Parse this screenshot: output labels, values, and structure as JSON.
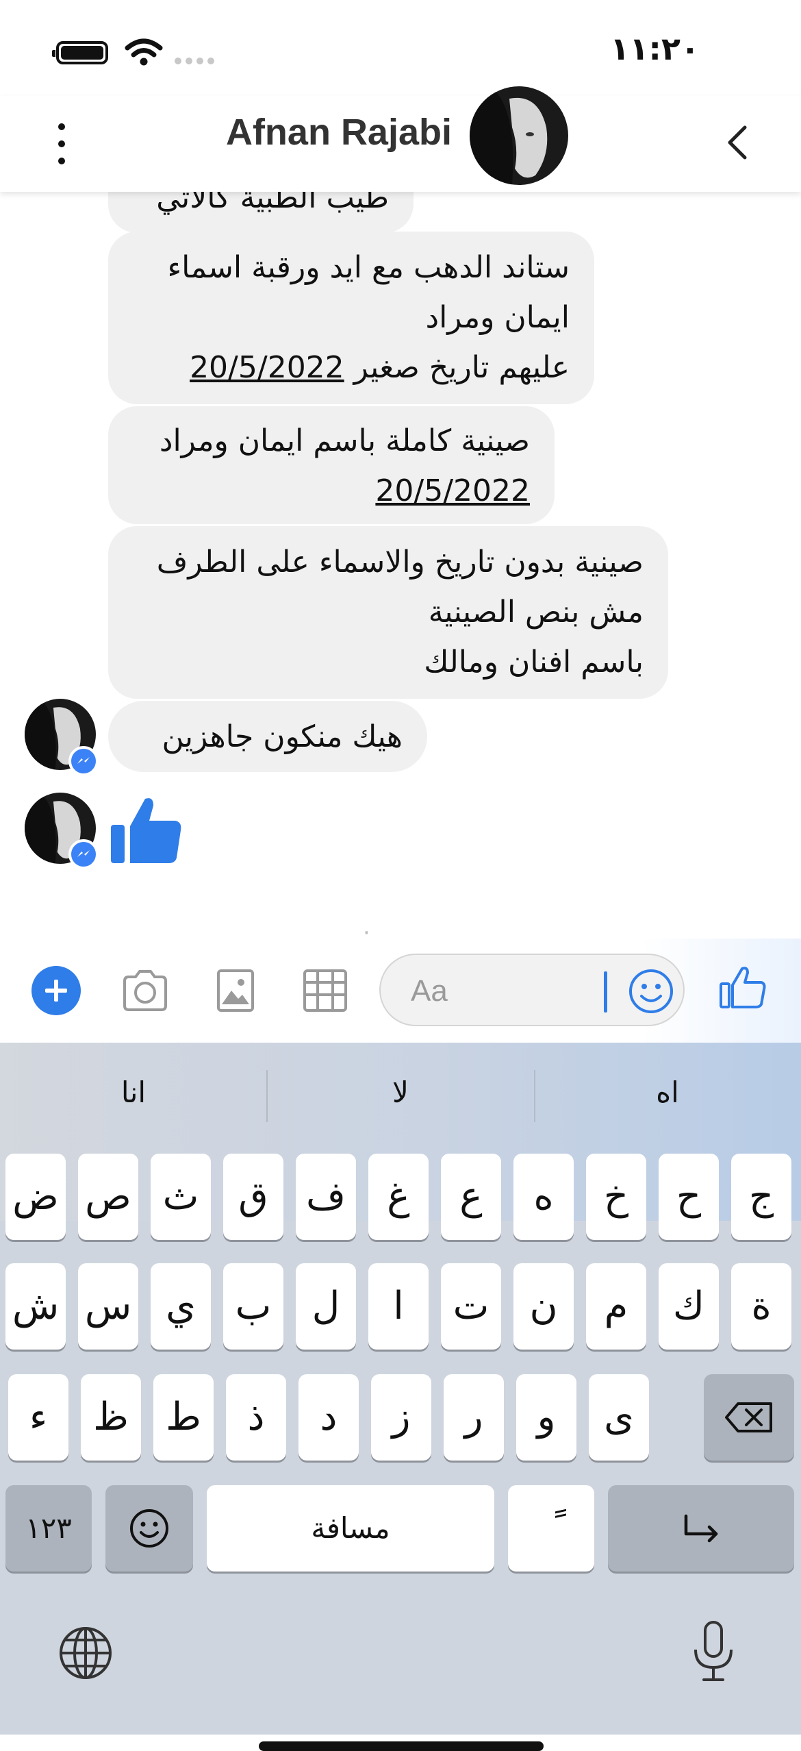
{
  "status_bar": {
    "time": "١١:٢٠"
  },
  "header": {
    "contact_name": "Afnan Rajabi"
  },
  "messages": [
    {
      "lines": [
        "طيب الطبية كالاتي"
      ]
    },
    {
      "lines": [
        "ستاند الدهب مع ايد ورقبة اسماء",
        "ايمان ومراد",
        "عليهم تاريخ صغير"
      ],
      "date": "20/5/2022"
    },
    {
      "lines": [
        "صينية كاملة باسم ايمان ومراد"
      ],
      "date": "20/5/2022"
    },
    {
      "lines": [
        "صينية بدون تاريخ والاسماء على الطرف",
        "مش بنص الصينية",
        "باسم افنان ومالك"
      ]
    },
    {
      "lines": [
        "هيك منكون جاهزين"
      ]
    }
  ],
  "composer": {
    "placeholder": "Aa"
  },
  "keyboard": {
    "suggestions": [
      "انا",
      "لا",
      "اه"
    ],
    "row1": [
      "ج",
      "ح",
      "خ",
      "ه",
      "ع",
      "غ",
      "ف",
      "ق",
      "ث",
      "ص",
      "ض"
    ],
    "row2": [
      "ة",
      "ك",
      "م",
      "ن",
      "ت",
      "ا",
      "ل",
      "ب",
      "ي",
      "س",
      "ش"
    ],
    "row3": [
      "ى",
      "و",
      "ر",
      "ز",
      "د",
      "ذ",
      "ط",
      "ظ",
      "ء"
    ],
    "numbers_label": "١٢٣",
    "space_label": "مسافة",
    "diacritic_label": "ً",
    "icons": [
      "delete-icon",
      "emoji-icon",
      "return-icon",
      "globe-icon",
      "microphone-icon"
    ]
  },
  "colors": {
    "accent": "#2f7de8",
    "bubble": "#f0f0f0",
    "keyboard": "#cfd5de"
  }
}
